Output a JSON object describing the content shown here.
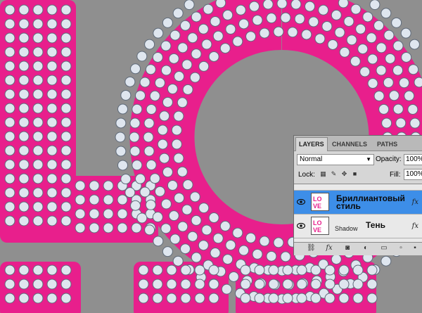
{
  "colors": {
    "pink": "#e81f8c",
    "gem": "#dfe6ef",
    "canvas": "#8f8f8f",
    "selected": "#3d8ee8"
  },
  "tabs": [
    {
      "label": "LAYERS"
    },
    {
      "label": "CHANNELS"
    },
    {
      "label": "PATHS"
    }
  ],
  "blend_mode": "Normal",
  "opacity": {
    "label": "Opacity:",
    "value": "100%"
  },
  "lock": {
    "label": "Lock:"
  },
  "fill": {
    "label": "Fill:",
    "value": "100%"
  },
  "layers": [
    {
      "name": "Бриллиантовый стиль",
      "name_line1": "Бриллиантовый",
      "name_line2": "стиль",
      "fx": "fx",
      "selected": true,
      "thumb": "LOVE"
    },
    {
      "name": "Shadow",
      "annotation": "Тень",
      "fx": "fx",
      "selected": false,
      "thumb": "LOVE"
    }
  ],
  "bottom_icons": [
    "link-icon",
    "fx-icon",
    "mask-icon",
    "adjustment-icon",
    "folder-icon",
    "new-layer-icon",
    "trash-icon"
  ],
  "fx_glyph": "fx",
  "eye_glyph": "◉"
}
